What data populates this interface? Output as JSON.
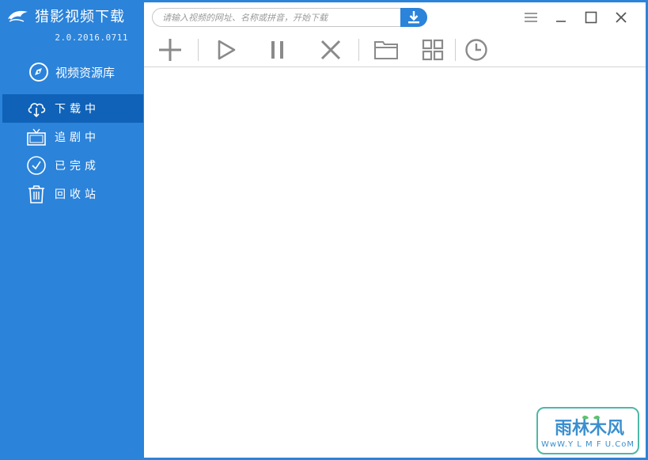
{
  "app": {
    "title": "猎影视频下载",
    "version": "2.0.2016.0711"
  },
  "sidebar": {
    "library": {
      "label": "视频资源库",
      "icon": "compass-icon"
    },
    "items": [
      {
        "label": "下载中",
        "icon": "cloud-download-icon",
        "active": true
      },
      {
        "label": "追剧中",
        "icon": "tv-icon",
        "active": false
      },
      {
        "label": "已完成",
        "icon": "check-circle-icon",
        "active": false
      },
      {
        "label": "回收站",
        "icon": "trash-icon",
        "active": false
      }
    ]
  },
  "search": {
    "placeholder": "请输入视频的网址、名称或拼音，开始下载",
    "value": "",
    "button_icon": "download-arrow-icon"
  },
  "window_controls": [
    "menu-icon",
    "minimize-icon",
    "maximize-icon",
    "close-icon"
  ],
  "toolbar": [
    "add-icon",
    "play-icon",
    "pause-icon",
    "delete-icon",
    "folder-icon",
    "grid-icon",
    "clock-icon"
  ],
  "watermark": {
    "brand": "雨林木风",
    "url": "WwW.Y L M F U.CoM"
  },
  "colors": {
    "sidebar": "#2b83da",
    "active_item": "#0f62b8",
    "toolbar_icon": "#8a8a8a",
    "watermark_border": "#4db8a8"
  }
}
